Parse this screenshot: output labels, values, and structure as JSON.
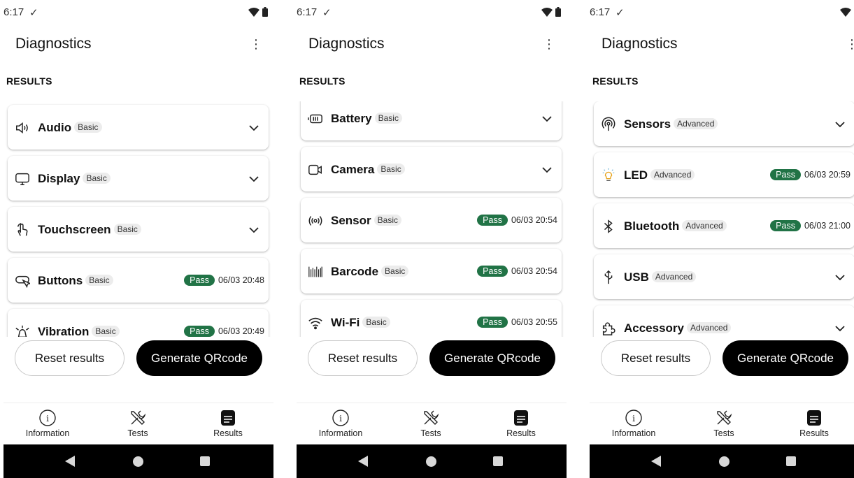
{
  "screens": [
    {
      "status": {
        "time": "6:17",
        "check": "✓"
      },
      "title": "Diagnostics",
      "menu_glyph": "⋮",
      "section": "RESULTS",
      "cards": [
        {
          "icon": "speaker-icon",
          "name": "Audio",
          "tag": "Basic",
          "status": "collapsed"
        },
        {
          "icon": "monitor-icon",
          "name": "Display",
          "tag": "Basic",
          "status": "collapsed"
        },
        {
          "icon": "touch-icon",
          "name": "Touchscreen",
          "tag": "Basic",
          "status": "collapsed"
        },
        {
          "icon": "buttons-icon",
          "name": "Buttons",
          "tag": "Basic",
          "status": "pass",
          "badge": "Pass",
          "date": "06/03 20:48"
        },
        {
          "icon": "vibration-icon",
          "name": "Vibration",
          "tag": "Basic",
          "status": "pass",
          "badge": "Pass",
          "date": "06/03 20:49"
        }
      ],
      "buttons": {
        "reset": "Reset results",
        "qr": "Generate QRcode"
      },
      "nav": {
        "info": "Information",
        "tests": "Tests",
        "results": "Results"
      }
    },
    {
      "status": {
        "time": "6:17",
        "check": "✓"
      },
      "title": "Diagnostics",
      "menu_glyph": "⋮",
      "section": "RESULTS",
      "cards": [
        {
          "icon": "battery-icon",
          "name": "Battery",
          "tag": "Basic",
          "status": "collapsed"
        },
        {
          "icon": "camera-icon",
          "name": "Camera",
          "tag": "Basic",
          "status": "collapsed"
        },
        {
          "icon": "sensor-icon",
          "name": "Sensor",
          "tag": "Basic",
          "status": "pass",
          "badge": "Pass",
          "date": "06/03 20:54"
        },
        {
          "icon": "barcode-icon",
          "name": "Barcode",
          "tag": "Basic",
          "status": "pass",
          "badge": "Pass",
          "date": "06/03 20:54"
        },
        {
          "icon": "wifi-icon",
          "name": "Wi-Fi",
          "tag": "Basic",
          "status": "pass",
          "badge": "Pass",
          "date": "06/03 20:55"
        }
      ],
      "buttons": {
        "reset": "Reset results",
        "qr": "Generate QRcode"
      },
      "nav": {
        "info": "Information",
        "tests": "Tests",
        "results": "Results"
      }
    },
    {
      "status": {
        "time": "6:17",
        "check": "✓"
      },
      "title": "Diagnostics",
      "menu_glyph": "⋮",
      "section": "RESULTS",
      "cards": [
        {
          "icon": "sensors-icon",
          "name": "Sensors",
          "tag": "Advanced",
          "status": "collapsed"
        },
        {
          "icon": "led-icon",
          "name": "LED",
          "tag": "Advanced",
          "status": "pass",
          "badge": "Pass",
          "date": "06/03 20:59"
        },
        {
          "icon": "bluetooth-icon",
          "name": "Bluetooth",
          "tag": "Advanced",
          "status": "pass",
          "badge": "Pass",
          "date": "06/03 21:00"
        },
        {
          "icon": "usb-icon",
          "name": "USB",
          "tag": "Advanced",
          "status": "collapsed"
        },
        {
          "icon": "accessory-icon",
          "name": "Accessory",
          "tag": "Advanced",
          "status": "collapsed"
        }
      ],
      "buttons": {
        "reset": "Reset results",
        "qr": "Generate QRcode"
      },
      "nav": {
        "info": "Information",
        "tests": "Tests",
        "results": "Results"
      }
    }
  ],
  "colors": {
    "pass": "#217346",
    "primary_button": "#000000",
    "system_nav": "#000000"
  }
}
